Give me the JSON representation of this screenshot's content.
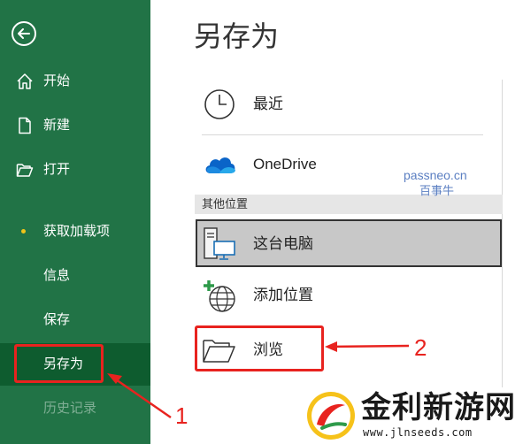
{
  "sidebar": {
    "back_icon": "back-arrow-icon",
    "items": [
      {
        "label": "开始",
        "icon": "home-icon"
      },
      {
        "label": "新建",
        "icon": "new-document-icon"
      },
      {
        "label": "打开",
        "icon": "open-folder-icon"
      },
      {
        "label": "获取加载项"
      },
      {
        "label": "信息"
      },
      {
        "label": "保存"
      },
      {
        "label": "另存为",
        "state": "selected"
      },
      {
        "label": "历史记录",
        "state": "disabled"
      }
    ]
  },
  "main": {
    "title": "另存为",
    "recent": {
      "label": "最近",
      "icon": "clock-icon"
    },
    "onedrive": {
      "label": "OneDrive",
      "icon": "cloud-icon"
    },
    "other_locations_header": "其他位置",
    "this_pc": {
      "label": "这台电脑",
      "icon": "computer-icon"
    },
    "add_location": {
      "label": "添加位置",
      "icon": "add-globe-icon"
    },
    "browse": {
      "label": "浏览",
      "icon": "folder-icon"
    }
  },
  "watermark": {
    "line1": "passneo.cn",
    "line2": "百事牛"
  },
  "annotations": {
    "callout_1": "1",
    "callout_2": "2"
  },
  "logo": {
    "text": "金利新游网",
    "url": "www.jlnseeds.com"
  },
  "colors": {
    "sidebar_bg": "#217346",
    "sidebar_selected_bg": "#0e5c2f",
    "annotation_red": "#e8231f",
    "accent_dot": "#f0c419"
  }
}
